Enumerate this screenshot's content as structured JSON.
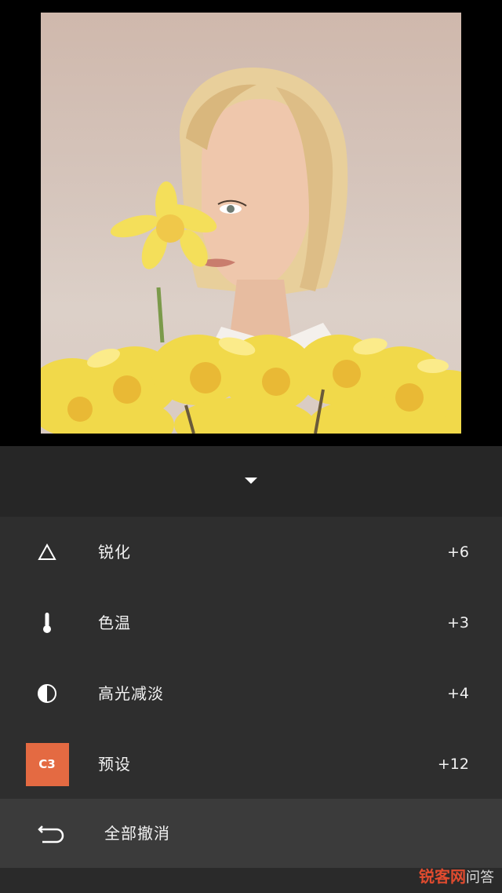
{
  "adjustments": [
    {
      "id": "sharpen",
      "label": "锐化",
      "value": "+6",
      "icon": "triangle-icon"
    },
    {
      "id": "temperature",
      "label": "色温",
      "value": "+3",
      "icon": "thermometer-icon"
    },
    {
      "id": "highlights",
      "label": "高光减淡",
      "value": "+4",
      "icon": "half-circle-icon"
    },
    {
      "id": "preset",
      "label": "预设",
      "value": "+12",
      "badge": "C3",
      "badge_color": "#e46a42"
    }
  ],
  "undo_all": {
    "label": "全部撤消",
    "icon": "undo-icon"
  },
  "watermark": {
    "brand": "锐客网",
    "sub": "问答"
  },
  "colors": {
    "panel": "#2e2e2e",
    "panel_dark": "#262626",
    "undo_row": "#3b3b3b",
    "accent": "#e46a42"
  }
}
